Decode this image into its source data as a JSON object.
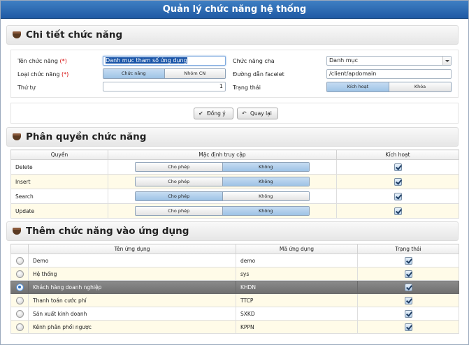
{
  "window": {
    "title": "Quản lý chức năng hệ thống"
  },
  "detail": {
    "section_title": "Chi tiết chức năng",
    "name_label": "Tên chức năng",
    "name_value": "Danh mục tham số ứng dụng",
    "parent_label": "Chức năng cha",
    "parent_value": "Danh mục",
    "type_label": "Loại chức năng",
    "type_options": [
      "Chức năng",
      "Nhóm CN"
    ],
    "type_selected": "Chức năng",
    "facelet_label": "Đường dẫn facelet",
    "facelet_value": "/client/apdomain",
    "order_label": "Thứ tự",
    "order_value": "1",
    "status_label": "Trạng thái",
    "status_options": [
      "Kích hoạt",
      "Khóa"
    ],
    "status_selected": "Kích hoạt",
    "required_mark": "(*)"
  },
  "actions": {
    "ok_label": "Đồng ý",
    "back_label": "Quay lại"
  },
  "permissions": {
    "section_title": "Phân quyền chức năng",
    "columns": [
      "Quyền",
      "Mặc định truy cập",
      "Kích hoạt"
    ],
    "access_options": [
      "Cho phép",
      "Không"
    ],
    "rows": [
      {
        "name": "Delete",
        "access": "Không",
        "active": true
      },
      {
        "name": "Insert",
        "access": "Không",
        "active": true
      },
      {
        "name": "Search",
        "access": "Cho phép",
        "active": true
      },
      {
        "name": "Update",
        "access": "Không",
        "active": true
      }
    ]
  },
  "apps": {
    "section_title": "Thêm chức năng vào ứng dụng",
    "columns": [
      "",
      "Tên ứng dụng",
      "Mã ứng dụng",
      "Trạng thái"
    ],
    "rows": [
      {
        "name": "Demo",
        "code": "demo",
        "status": true,
        "selected": false
      },
      {
        "name": "Hệ thống",
        "code": "sys",
        "status": true,
        "selected": false
      },
      {
        "name": "Khách hàng doanh nghiệp",
        "code": "KHDN",
        "status": true,
        "selected": true
      },
      {
        "name": "Thanh toán cước phí",
        "code": "TTCP",
        "status": true,
        "selected": false
      },
      {
        "name": "Sản xuất kinh doanh",
        "code": "SXKD",
        "status": true,
        "selected": false
      },
      {
        "name": "Kênh phân phối ngược",
        "code": "KPPN",
        "status": true,
        "selected": false
      }
    ]
  },
  "icons": {
    "section": "coffee-cup-icon",
    "ok": "check-icon",
    "back": "back-arrow-icon"
  },
  "colors": {
    "titlebar": "#2a67b1",
    "selected_row": "#7c7c7c",
    "alt_row": "#fffbe8",
    "toggle_on": "#a9cbea"
  }
}
